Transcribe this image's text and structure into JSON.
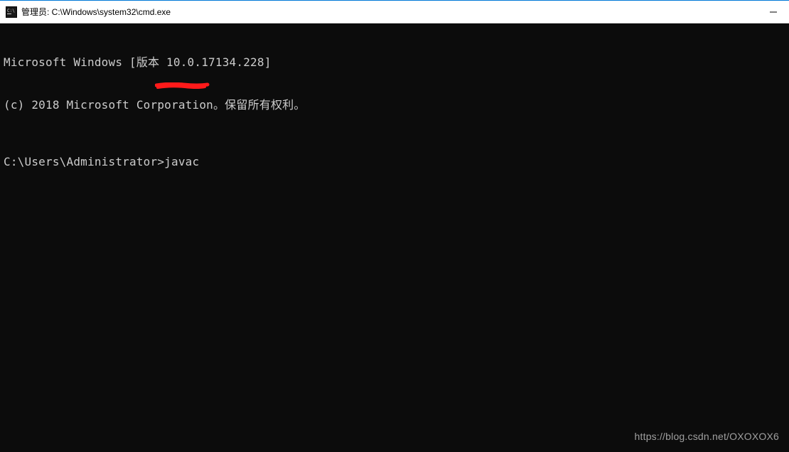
{
  "titlebar": {
    "title": "管理员: C:\\Windows\\system32\\cmd.exe"
  },
  "terminal": {
    "line1": "Microsoft Windows [版本 10.0.17134.228]",
    "line2": "(c) 2018 Microsoft Corporation。保留所有权利。",
    "prompt": "C:\\Users\\Administrator>",
    "command": "javac"
  },
  "watermark": "https://blog.csdn.net/OXOXOX6",
  "annotation": {
    "underline_color": "#ff1a1a"
  }
}
